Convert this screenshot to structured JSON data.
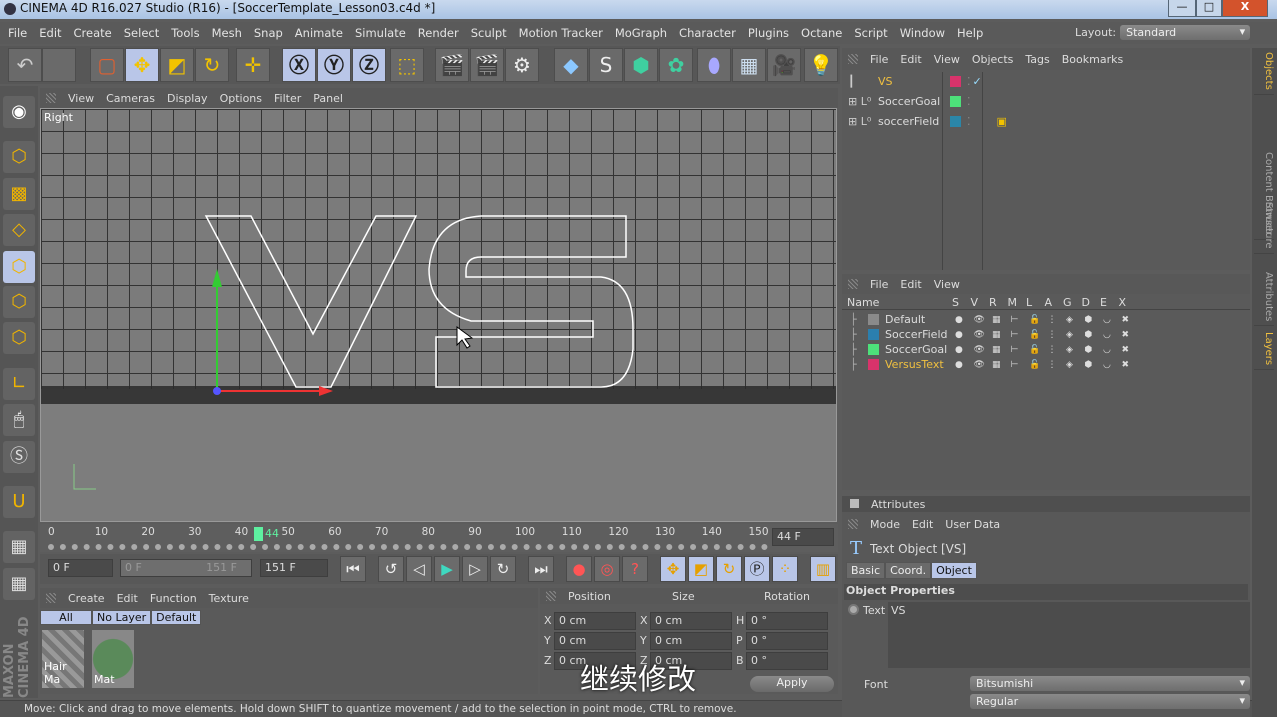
{
  "window": {
    "title": "CINEMA 4D R16.027 Studio (R16) - [SoccerTemplate_Lesson03.c4d *]",
    "min": "—",
    "max": "□",
    "close": "X"
  },
  "menu": [
    "File",
    "Edit",
    "Create",
    "Select",
    "Tools",
    "Mesh",
    "Snap",
    "Animate",
    "Simulate",
    "Render",
    "Sculpt",
    "Motion Tracker",
    "MoGraph",
    "Character",
    "Plugins",
    "Octane",
    "Script",
    "Window",
    "Help"
  ],
  "layout": {
    "label": "Layout:",
    "value": "Standard"
  },
  "viewport": {
    "menu": [
      "View",
      "Cameras",
      "Display",
      "Options",
      "Filter",
      "Panel"
    ],
    "label": "Right",
    "text_object": "VS"
  },
  "timeline": {
    "ticks": [
      "0",
      "10",
      "20",
      "30",
      "40",
      "50",
      "60",
      "70",
      "80",
      "90",
      "100",
      "110",
      "120",
      "130",
      "140",
      "150"
    ],
    "current": "44",
    "current_field": "44 F",
    "start": "0 F",
    "range_start": "0 F",
    "range_end": "151 F",
    "end": "151 F"
  },
  "materials": {
    "menu": [
      "Create",
      "Edit",
      "Function",
      "Texture"
    ],
    "filters": [
      "All",
      "No Layer",
      "Default"
    ],
    "items": [
      "Hair Ma",
      "Mat"
    ]
  },
  "coords": {
    "headers": [
      "Position",
      "Size",
      "Rotation"
    ],
    "pos": [
      {
        "axis": "X",
        "value": "0 cm"
      },
      {
        "axis": "Y",
        "value": "0 cm"
      },
      {
        "axis": "Z",
        "value": "0 cm"
      }
    ],
    "size": [
      {
        "axis": "X",
        "value": "0 cm"
      },
      {
        "axis": "Y",
        "value": "0 cm"
      },
      {
        "axis": "Z",
        "value": "0 cm"
      }
    ],
    "rot": [
      {
        "axis": "H",
        "value": "0 °"
      },
      {
        "axis": "P",
        "value": "0 °"
      },
      {
        "axis": "B",
        "value": "0 °"
      }
    ],
    "apply": "Apply"
  },
  "subtitle": "继续修改",
  "status": "Move: Click and drag to move elements. Hold down SHIFT to quantize movement / add to the selection in point mode, CTRL to remove.",
  "objects": {
    "menu": [
      "File",
      "Edit",
      "View",
      "Objects",
      "Tags",
      "Bookmarks"
    ],
    "items": [
      {
        "name": "VS",
        "color": "#d8336b"
      },
      {
        "name": "SoccerGoal",
        "color": "#4de07a"
      },
      {
        "name": "soccerField",
        "color": "#2b86a8"
      }
    ]
  },
  "layers": {
    "menu": [
      "File",
      "Edit",
      "View"
    ],
    "columns": [
      "Name",
      "S",
      "V",
      "R",
      "M",
      "L",
      "A",
      "G",
      "D",
      "E",
      "X"
    ],
    "items": [
      {
        "name": "Default",
        "color": "#8a8a8a"
      },
      {
        "name": "SoccerField",
        "color": "#2b7fae"
      },
      {
        "name": "SoccerGoal",
        "color": "#4de07a"
      },
      {
        "name": "VersusText",
        "color": "#d8336b"
      }
    ]
  },
  "attributes": {
    "title": "Attributes",
    "menu": [
      "Mode",
      "Edit",
      "User Data"
    ],
    "object": "Text Object [VS]",
    "tabs": [
      "Basic",
      "Coord.",
      "Object"
    ],
    "section": "Object Properties",
    "text_label": "Text",
    "text_value": "VS",
    "font_label": "Font",
    "font": "Bitsumishi",
    "style": "Regular"
  },
  "right_tabs": [
    "Objects",
    "Content Browser",
    "Structure",
    "Attributes",
    "Layers"
  ],
  "brand": "MAXON CINEMA 4D"
}
